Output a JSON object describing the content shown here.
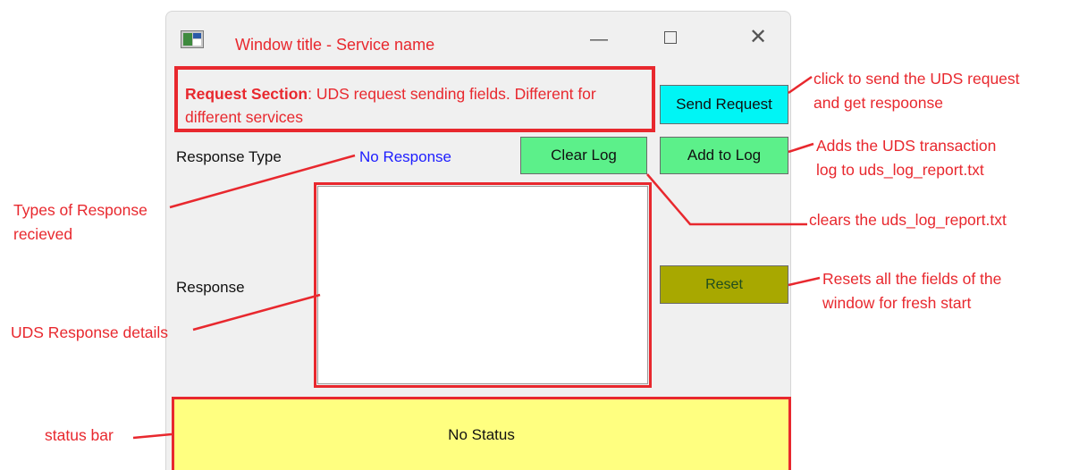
{
  "window": {
    "title": "Window title - Service name",
    "controls": {
      "minimize": "—",
      "close": "✕"
    }
  },
  "request_section": {
    "heading": "Request Section",
    "description": ": UDS request sending fields. Different for different services"
  },
  "buttons": {
    "send_request": "Send Request",
    "clear_log": "Clear Log",
    "add_to_log": "Add to Log",
    "reset": "Reset"
  },
  "labels": {
    "response_type": "Response Type",
    "response_type_value": "No Response",
    "response": "Response"
  },
  "status_bar": {
    "text": "No Status"
  },
  "annotations": {
    "send": [
      "click to send the UDS request",
      "and get respoonse"
    ],
    "add": [
      "Adds the UDS transaction",
      "log to uds_log_report.txt"
    ],
    "clear": "clears the uds_log_report.txt",
    "reset": [
      "Resets all the fields of the",
      "window for fresh start"
    ],
    "types": [
      "Types of Response",
      "recieved"
    ],
    "uds_response": "UDS Response details",
    "status": "status bar"
  },
  "colors": {
    "annotation_red": "#e8282e",
    "send_button": "#00f5f5",
    "log_buttons": "#5cf08a",
    "reset_button": "#a8a800",
    "status_bar": "#ffff80",
    "response_value_blue": "#1d1dff"
  }
}
